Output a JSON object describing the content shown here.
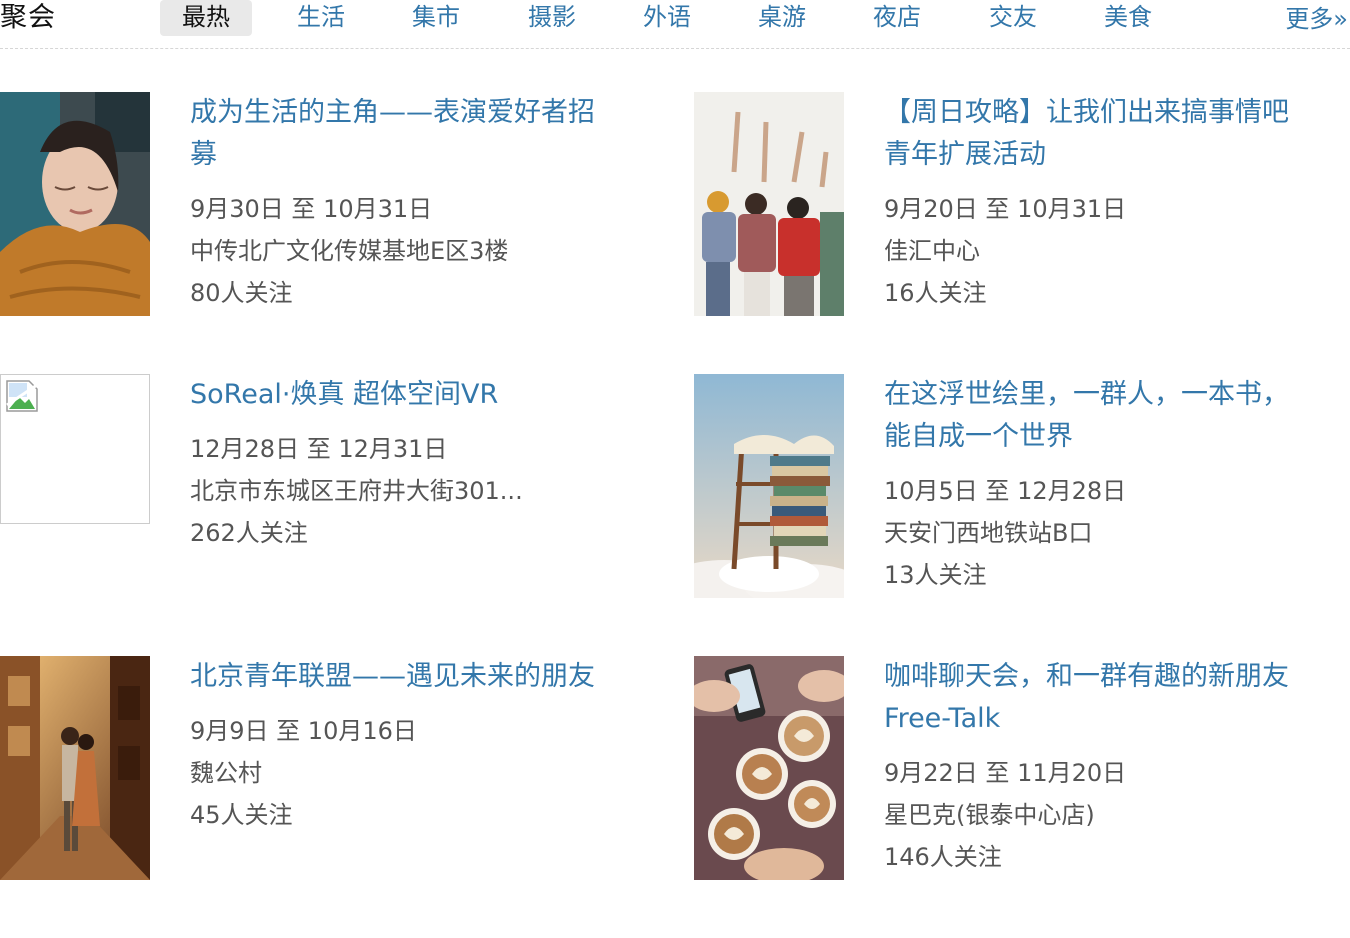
{
  "header": {
    "title": "聚会",
    "tabs": [
      {
        "label": "最热",
        "active": true
      },
      {
        "label": "生活",
        "active": false
      },
      {
        "label": "集市",
        "active": false
      },
      {
        "label": "摄影",
        "active": false
      },
      {
        "label": "外语",
        "active": false
      },
      {
        "label": "桌游",
        "active": false
      },
      {
        "label": "夜店",
        "active": false
      },
      {
        "label": "交友",
        "active": false
      },
      {
        "label": "美食",
        "active": false
      }
    ],
    "more": "更多»"
  },
  "colors": {
    "link": "#3377aa",
    "text": "#555555",
    "active_tab_bg": "#e9e9e9"
  },
  "events": [
    {
      "title": "成为生活的主角——表演爱好者招募",
      "dates": "9月30日 至 10月31日",
      "location": "中传北广文化传媒基地E区3楼",
      "followers": "80人关注",
      "image": "portrait-photo"
    },
    {
      "title": "【周日攻略】让我们出来搞事情吧 青年扩展活动",
      "dates": "9月20日 至 10月31日",
      "location": "佳汇中心",
      "followers": "16人关注",
      "image": "group-raising-hands-illustration"
    },
    {
      "title": "SoReal·焕真 超体空间VR",
      "dates": "12月28日 至 12月31日",
      "location": "北京市东城区王府井大街301...",
      "followers": "262人关注",
      "image": "broken-image"
    },
    {
      "title": "在这浮世绘里，一群人，一本书，能自成一个世界",
      "dates": "10月5日 至 12月28日",
      "location": "天安门西地铁站B口",
      "followers": "13人关注",
      "image": "books-on-ladder-clouds"
    },
    {
      "title": "北京青年联盟——遇见未来的朋友",
      "dates": "9月9日 至 10月16日",
      "location": "魏公村",
      "followers": "45人关注",
      "image": "couple-street-photo"
    },
    {
      "title": "咖啡聊天会，和一群有趣的新朋友 Free-Talk",
      "dates": "9月22日 至 11月20日",
      "location": "星巴克(银泰中心店)",
      "followers": "146人关注",
      "image": "coffee-cups-photo"
    }
  ]
}
